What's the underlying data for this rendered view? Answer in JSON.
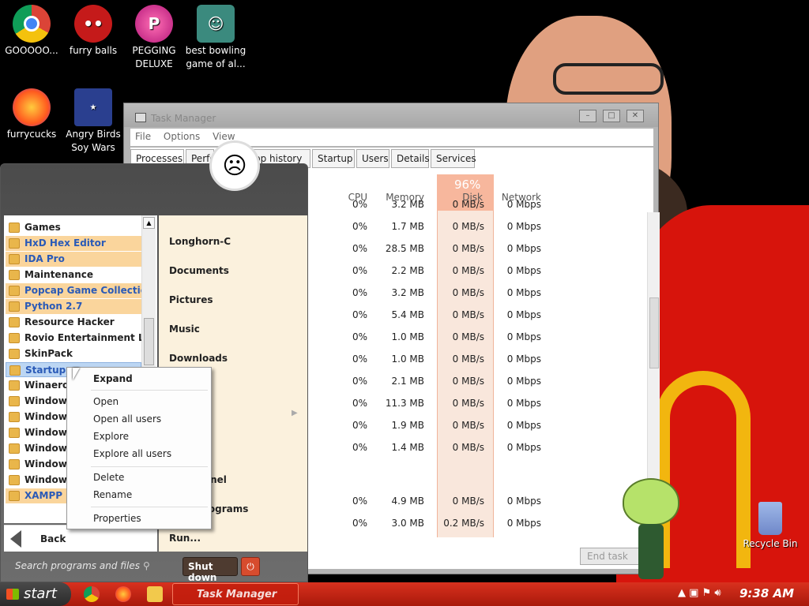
{
  "desktop": {
    "icons": [
      {
        "label": "GOOOOO...",
        "icon": "chrome-icon"
      },
      {
        "label": "furry balls",
        "icon": "furry-ball-icon"
      },
      {
        "label": "PEGGING DELUXE",
        "icon": "peggle-icon"
      },
      {
        "label": "best bowling game of al...",
        "icon": "bowling-icon"
      },
      {
        "label": "furrycucks",
        "icon": "firefox-icon"
      },
      {
        "label": "Angry Birds Soy Wars",
        "icon": "angry-birds-icon"
      }
    ],
    "recycle_bin": "Recycle Bin"
  },
  "task_manager": {
    "title": "Task Manager",
    "menu": [
      "File",
      "Options",
      "View"
    ],
    "tabs": [
      "Processes",
      "Perfo",
      "pp history",
      "Startup",
      "Users",
      "Details",
      "Services"
    ],
    "columns": {
      "cpu": "CPU",
      "memory": "Memory",
      "disk": "Disk",
      "network": "Network"
    },
    "disk_usage": "96%",
    "rows": [
      {
        "cpu": "0%",
        "memory": "3.2 MB",
        "disk": "0 MB/s",
        "network": "0 Mbps"
      },
      {
        "cpu": "0%",
        "memory": "1.7 MB",
        "disk": "0 MB/s",
        "network": "0 Mbps"
      },
      {
        "cpu": "0%",
        "memory": "28.5 MB",
        "disk": "0 MB/s",
        "network": "0 Mbps"
      },
      {
        "cpu": "0%",
        "memory": "2.2 MB",
        "disk": "0 MB/s",
        "network": "0 Mbps"
      },
      {
        "cpu": "0%",
        "memory": "3.2 MB",
        "disk": "0 MB/s",
        "network": "0 Mbps"
      },
      {
        "cpu": "0%",
        "memory": "5.4 MB",
        "disk": "0 MB/s",
        "network": "0 Mbps"
      },
      {
        "cpu": "0%",
        "memory": "1.0 MB",
        "disk": "0 MB/s",
        "network": "0 Mbps"
      },
      {
        "cpu": "0%",
        "memory": "1.0 MB",
        "disk": "0 MB/s",
        "network": "0 Mbps"
      },
      {
        "cpu": "0%",
        "memory": "2.1 MB",
        "disk": "0 MB/s",
        "network": "0 Mbps"
      },
      {
        "cpu": "0%",
        "memory": "11.3 MB",
        "disk": "0 MB/s",
        "network": "0 Mbps"
      },
      {
        "cpu": "0%",
        "memory": "1.9 MB",
        "disk": "0 MB/s",
        "network": "0 Mbps"
      },
      {
        "cpu": "0%",
        "memory": "1.4 MB",
        "disk": "0 MB/s",
        "network": "0 Mbps"
      },
      {
        "cpu": "0%",
        "memory": "4.9 MB",
        "disk": "0 MB/s",
        "network": "0 Mbps"
      },
      {
        "cpu": "0%",
        "memory": "3.0 MB",
        "disk": "0.2 MB/s",
        "network": "0 Mbps"
      }
    ],
    "end_task": "End task"
  },
  "start_menu": {
    "programs": [
      {
        "label": "Games",
        "highlight": false
      },
      {
        "label": "HxD Hex Editor",
        "highlight": true
      },
      {
        "label": "IDA Pro",
        "highlight": true
      },
      {
        "label": "Maintenance",
        "highlight": false
      },
      {
        "label": "Popcap Game Collection",
        "highlight": true
      },
      {
        "label": "Python 2.7",
        "highlight": true
      },
      {
        "label": "Resource Hacker",
        "highlight": false
      },
      {
        "label": "Rovio Entertainment Ltd",
        "highlight": false
      },
      {
        "label": "SkinPack",
        "highlight": false
      },
      {
        "label": "Startup",
        "highlight": false,
        "selected": true
      },
      {
        "label": "Winaero",
        "highlight": false
      },
      {
        "label": "Windows",
        "highlight": false
      },
      {
        "label": "Windows",
        "highlight": false
      },
      {
        "label": "Windows",
        "highlight": false
      },
      {
        "label": "Windows",
        "highlight": false
      },
      {
        "label": "Windows",
        "highlight": false
      },
      {
        "label": "Windows",
        "highlight": false
      },
      {
        "label": "XAMPP",
        "highlight": true
      }
    ],
    "back": "Back",
    "right_items": [
      "Longhorn-C",
      "Documents",
      "Pictures",
      "Music",
      "Downloads",
      "anel",
      "rograms",
      "Run..."
    ],
    "search_placeholder": "Search programs and files",
    "shutdown": "Shut down"
  },
  "context_menu": {
    "items": [
      "Expand",
      "Open",
      "Open all users",
      "Explore",
      "Explore all users",
      "Delete",
      "Rename",
      "Properties"
    ]
  },
  "taskbar": {
    "start": "start",
    "task": "Task Manager",
    "clock": "9:38 AM"
  }
}
